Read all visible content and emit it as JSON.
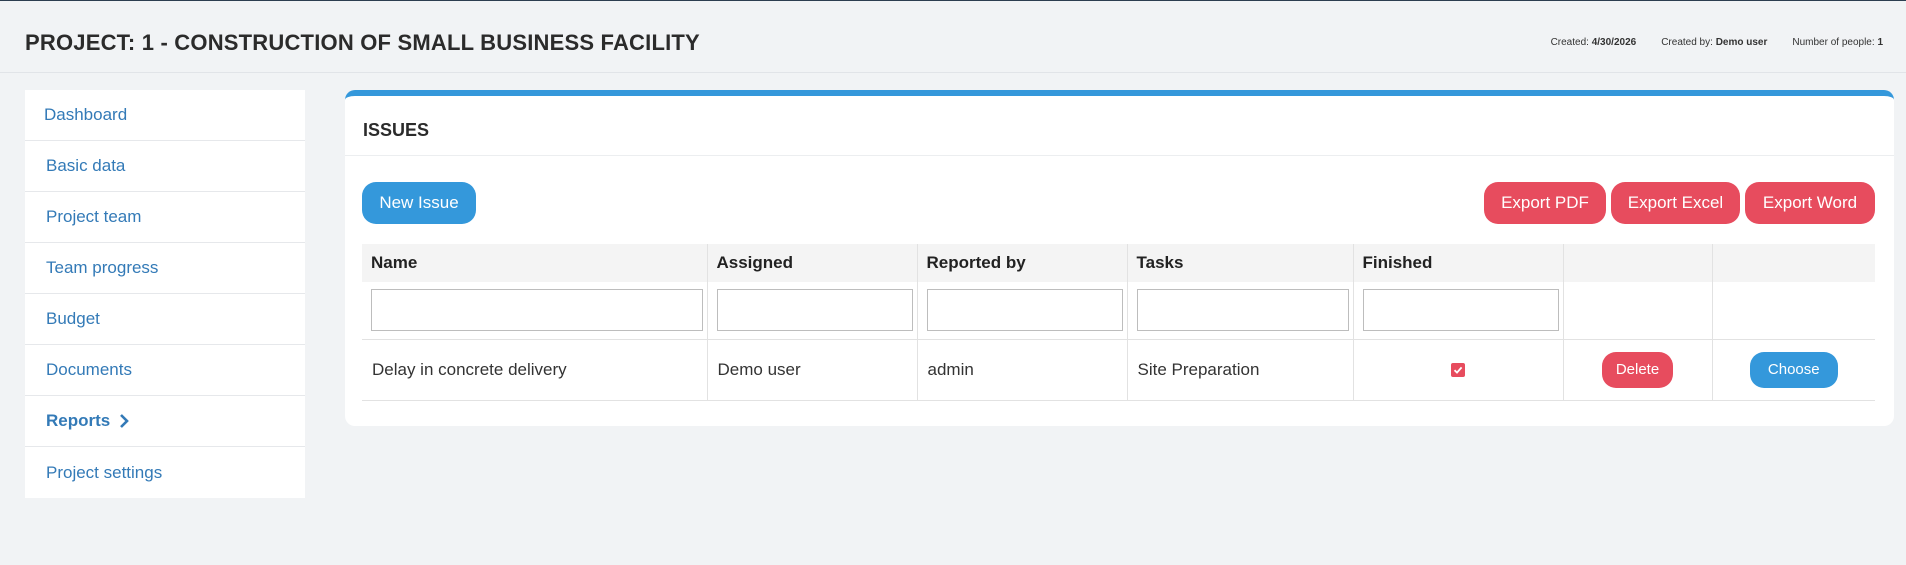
{
  "header": {
    "title": "PROJECT: 1 - CONSTRUCTION OF SMALL BUSINESS FACILITY",
    "created_label": "Created:",
    "created_value": "4/30/2026",
    "created_by_label": "Created by:",
    "created_by_value": "Demo user",
    "people_label": "Number of people:",
    "people_value": "1"
  },
  "sidebar": {
    "items": [
      {
        "label": "Dashboard"
      },
      {
        "label": "Basic data"
      },
      {
        "label": "Project team"
      },
      {
        "label": "Team progress"
      },
      {
        "label": "Budget"
      },
      {
        "label": "Documents"
      },
      {
        "label": "Reports",
        "icon": "chevron-right-icon"
      },
      {
        "label": "Project settings"
      }
    ]
  },
  "issues": {
    "title": "ISSUES",
    "new_issue_label": "New Issue",
    "export_pdf_label": "Export PDF",
    "export_excel_label": "Export Excel",
    "export_word_label": "Export Word",
    "columns": [
      "Name",
      "Assigned",
      "Reported by",
      "Tasks",
      "Finished",
      "",
      ""
    ],
    "rows": [
      {
        "name": "Delay in concrete delivery",
        "assigned": "Demo user",
        "reported_by": "admin",
        "tasks": "Site Preparation",
        "finished": true,
        "delete_label": "Delete",
        "choose_label": "Choose"
      }
    ]
  },
  "colors": {
    "accent_blue": "#3498db",
    "danger_red": "#e74c5e",
    "link_blue": "#337ab7"
  }
}
